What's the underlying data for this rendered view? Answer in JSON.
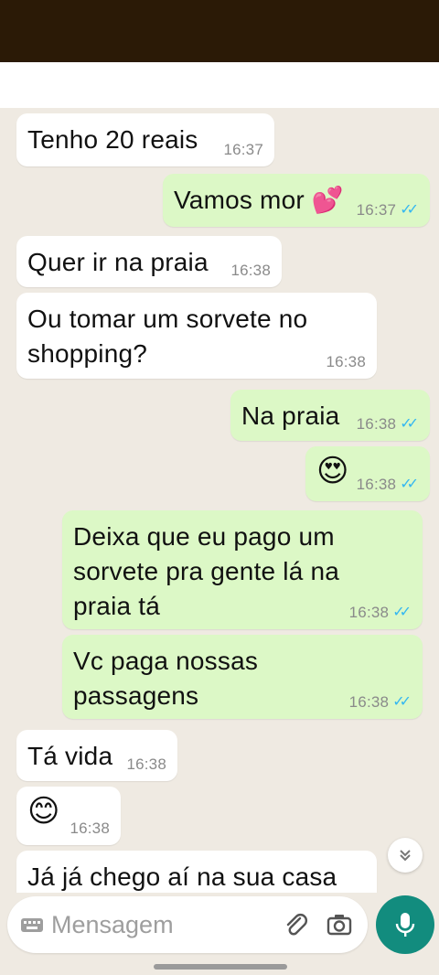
{
  "messages": [
    {
      "dir": "in",
      "text": "Tenho 20 reais",
      "time": "16:37"
    },
    {
      "dir": "out",
      "text": "Vamos mor",
      "emoji": "💕",
      "time": "16:37",
      "read": true
    },
    {
      "dir": "in",
      "text": "Quer ir na praia",
      "time": "16:38"
    },
    {
      "dir": "in",
      "text": "Ou tomar um sorvete no shopping?",
      "time": "16:38"
    },
    {
      "dir": "out",
      "text": "Na praia",
      "time": "16:38",
      "read": true
    },
    {
      "dir": "out",
      "emoji": "😍",
      "time": "16:38",
      "read": true
    },
    {
      "dir": "out",
      "text": "Deixa que eu pago um sorvete pra gente lá na praia tá",
      "time": "16:38",
      "read": true
    },
    {
      "dir": "out",
      "text": "Vc paga nossas passagens",
      "time": "16:38",
      "read": true
    },
    {
      "dir": "in",
      "text": "Tá vida",
      "time": "16:38"
    },
    {
      "dir": "in",
      "emoji": "😊",
      "time": "16:38"
    },
    {
      "dir": "in",
      "text": "Já já chego aí na sua casa"
    }
  ],
  "composer": {
    "placeholder": "Mensagem"
  },
  "icons": {
    "keyboard": "keyboard-icon",
    "attach": "paperclip-icon",
    "camera": "camera-icon",
    "mic": "microphone-icon",
    "scroll": "chevron-double-down-icon"
  },
  "colors": {
    "status_bar": "#2b1a06",
    "chat_bg": "#efeae2",
    "incoming": "#ffffff",
    "outgoing": "#dcf8c6",
    "read_ticks": "#34b7f1",
    "mic_button": "#128c7e"
  }
}
